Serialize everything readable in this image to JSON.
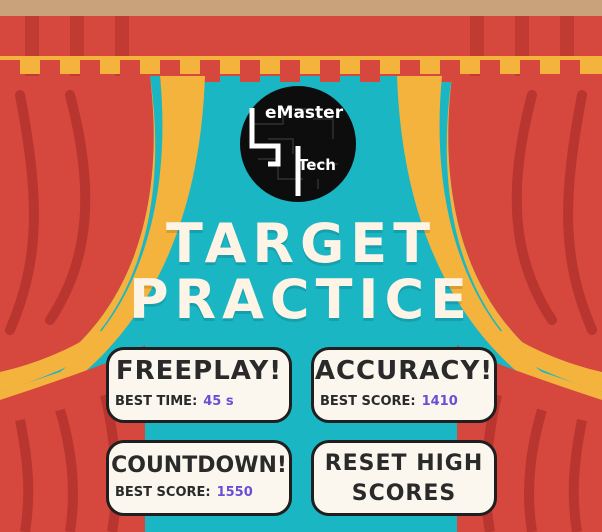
{
  "logo": {
    "text_line1": "eMaster",
    "text_line2": "Tech"
  },
  "title": {
    "line1": "TARGET",
    "line2": "PRACTICE"
  },
  "buttons": {
    "freeplay": {
      "label": "FREEPLAY!",
      "score_label": "BEST TIME:",
      "score_value": "45 s"
    },
    "accuracy": {
      "label": "ACCURACY!",
      "score_label": "BEST SCORE:",
      "score_value": "1410"
    },
    "countdown": {
      "label": "COUNTDOWN!",
      "score_label": "BEST SCORE:",
      "score_value": "1550"
    },
    "reset": {
      "label_line1": "RESET HIGH",
      "label_line2": "SCORES"
    }
  },
  "colors": {
    "background": "#1bb6c4",
    "curtain_red": "#d6473d",
    "curtain_dark": "#b9352f",
    "curtain_gold": "#f4b33c",
    "title_text": "#fdf4e6",
    "score_value": "#6a4fd6",
    "button_fill": "#fbf7ee"
  }
}
